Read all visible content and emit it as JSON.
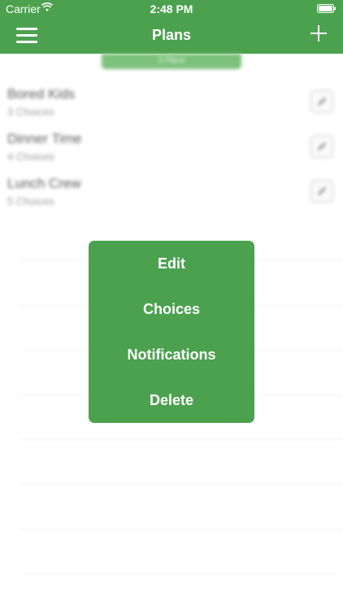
{
  "status_bar": {
    "carrier": "Carrier",
    "time": "2:48 PM",
    "wifi_icon": "wifi-icon",
    "battery_icon": "battery-icon"
  },
  "navbar": {
    "title": "Plans",
    "menu_icon": "hamburger-menu-icon",
    "add_icon": "plus-icon",
    "background_color": "#4ca14f"
  },
  "tab": {
    "label": "3 Plans"
  },
  "plans": [
    {
      "name": "Bored Kids",
      "count": "3 Choices"
    },
    {
      "name": "Dinner Time",
      "count": "4 Choices"
    },
    {
      "name": "Lunch Crew",
      "count": "5 Choices"
    }
  ],
  "popup_menu": {
    "items": [
      "Edit",
      "Choices",
      "Notifications",
      "Delete"
    ],
    "background_color": "#4ca14f"
  }
}
